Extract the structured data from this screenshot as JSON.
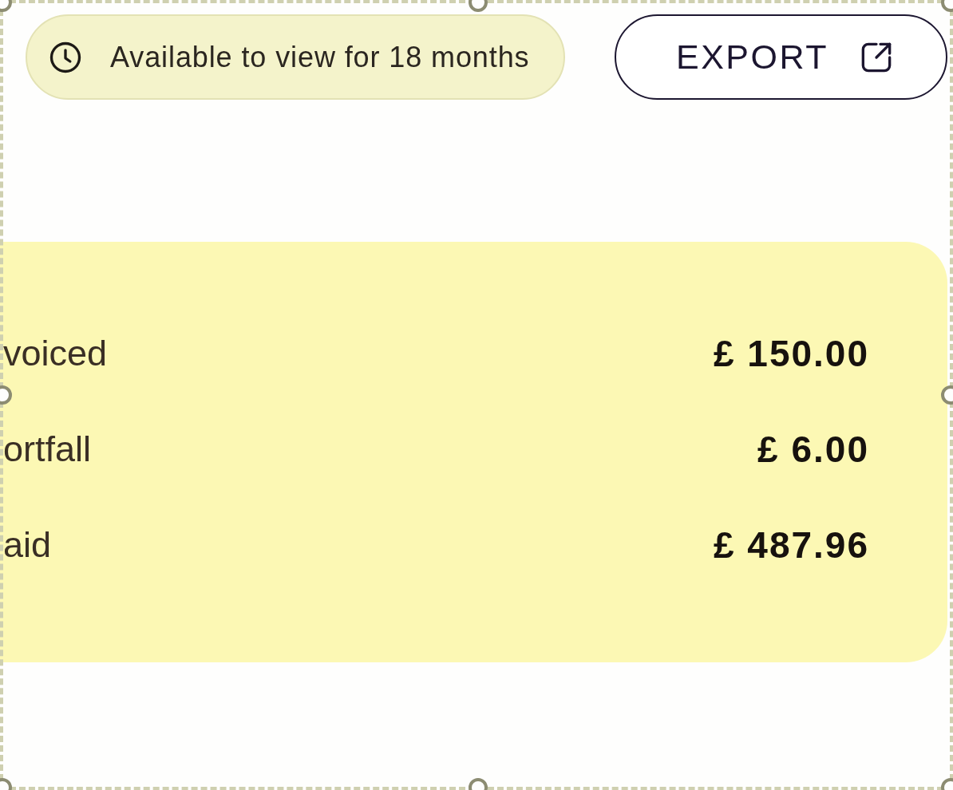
{
  "frame": {
    "selected": true
  },
  "notice": {
    "text": "Available to view for 18 months"
  },
  "export_button": {
    "label": "EXPORT"
  },
  "summary": {
    "rows": [
      {
        "label": "voiced",
        "amount": "£ 150.00"
      },
      {
        "label": "ortfall",
        "amount": "£ 6.00"
      },
      {
        "label": "aid",
        "amount": "£ 487.96"
      }
    ]
  }
}
